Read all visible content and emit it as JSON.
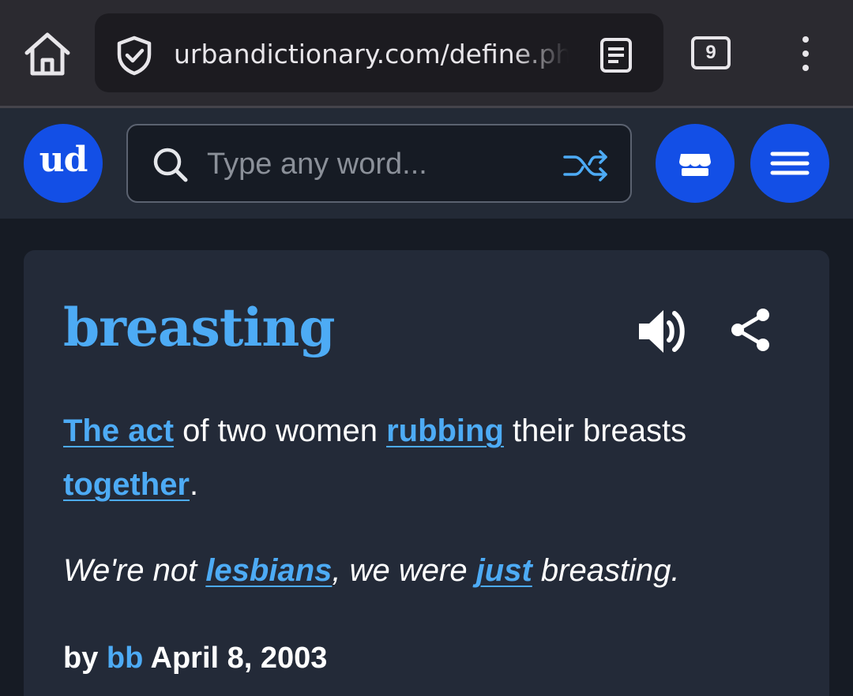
{
  "browser": {
    "url": "urbandictionary.com/define.php?term=breasting",
    "tab_count": "9"
  },
  "header": {
    "logo_text": "ud",
    "search_placeholder": "Type any word...",
    "accent_color": "#134fe6"
  },
  "definition": {
    "word": "breasting",
    "meaning": {
      "link_1": "The act",
      "text_1": " of two women ",
      "link_2": "rubbing",
      "text_2": " their breasts ",
      "link_3": "together",
      "text_3": "."
    },
    "example": {
      "text_1": "We're not ",
      "link_1": "lesbians",
      "text_2": ", we were ",
      "link_2": "just",
      "text_3": " breasting."
    },
    "byline": {
      "prefix": "by",
      "author": "bb",
      "date": "April 8, 2003"
    },
    "link_color": "#4dabf5"
  },
  "icons": [
    "home-icon",
    "shield-check-icon",
    "reader-mode-icon",
    "tabs-icon",
    "more-vert-icon",
    "search-icon",
    "shuffle-icon",
    "store-icon",
    "hamburger-menu-icon",
    "speaker-icon",
    "share-icon"
  ]
}
